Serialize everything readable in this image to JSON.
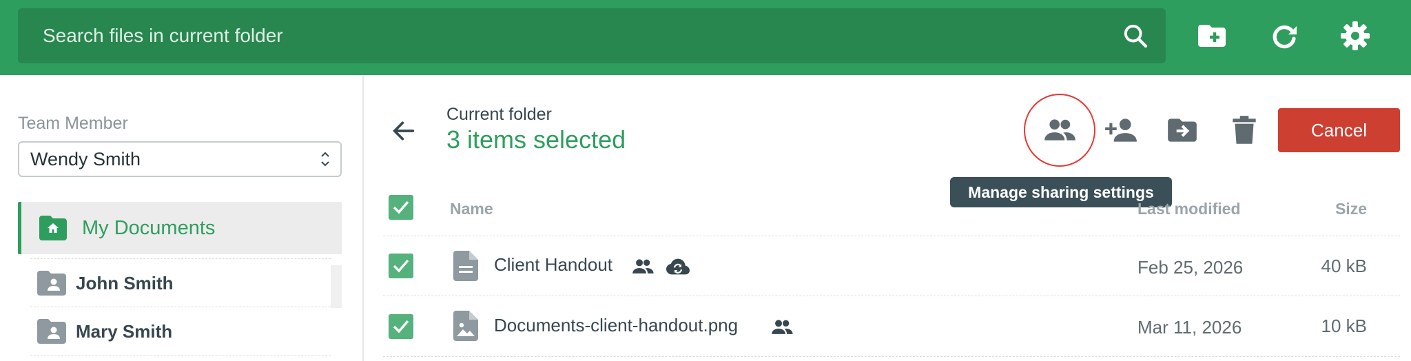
{
  "search": {
    "placeholder": "Search files in current folder"
  },
  "toolbar": {
    "icons": [
      "search-icon",
      "new-folder-icon",
      "refresh-icon",
      "settings-icon"
    ]
  },
  "sidebar": {
    "team_member_label": "Team Member",
    "team_member_value": "Wendy Smith",
    "root_item": "My Documents",
    "items": [
      {
        "label": "John Smith"
      },
      {
        "label": "Mary Smith"
      }
    ]
  },
  "main": {
    "folder_label": "Current folder",
    "selection_text": "3 items selected",
    "cancel_label": "Cancel",
    "tooltip": "Manage sharing settings",
    "columns": {
      "name": "Name",
      "last_modified": "Last modified",
      "size": "Size"
    },
    "files": [
      {
        "name": "Client Handout",
        "modified": "Feb 25, 2026",
        "size": "40 kB",
        "icons": [
          "shared-icon",
          "cloud-sync-icon"
        ]
      },
      {
        "name": "Documents-client-handout.png",
        "modified": "Mar 11, 2026",
        "size": "10 kB",
        "icons": [
          "shared-icon"
        ]
      }
    ]
  },
  "colors": {
    "brand_green": "#2e9e5e",
    "cancel_red": "#cc3f31",
    "highlight_ring": "#e53935",
    "tooltip_bg": "#3a4f57"
  }
}
